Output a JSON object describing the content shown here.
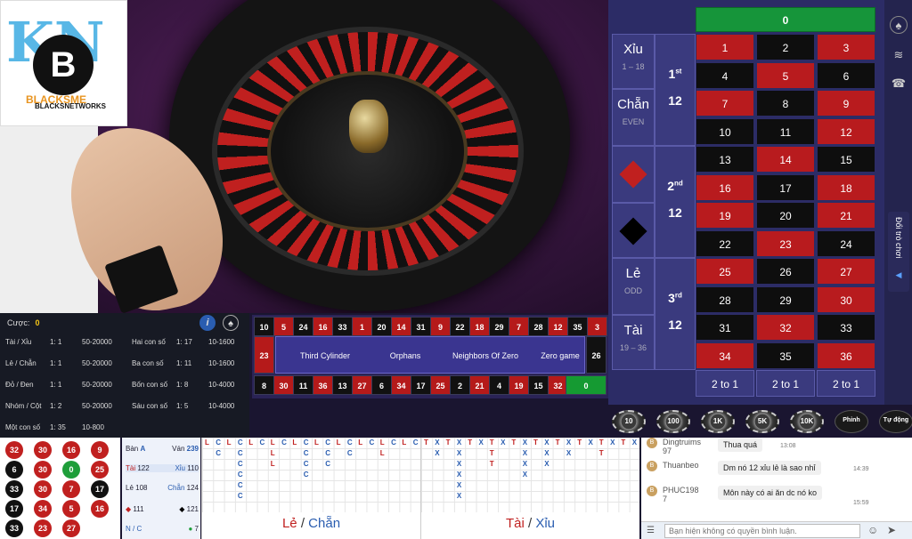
{
  "logo": {
    "letters": "KN",
    "circle_letter": "B",
    "tagline1": "BLACKS",
    "tagline2": "BLACKSNETWORKS",
    "domain_text": "ME"
  },
  "limits": {
    "bet_label": "Cược:",
    "bet_value": "0",
    "rows": [
      {
        "name": "Tài / Xỉu",
        "ratio": "1: 1",
        "range": "50-20000",
        "name2": "Hai con số",
        "ratio2": "1: 17",
        "range2": "10-1600"
      },
      {
        "name": "Lẻ / Chẵn",
        "ratio": "1: 1",
        "range": "50-20000",
        "name2": "Ba con số",
        "ratio2": "1: 11",
        "range2": "10-1600"
      },
      {
        "name": "Đỏ / Đen",
        "ratio": "1: 1",
        "range": "50-20000",
        "name2": "Bốn con số",
        "ratio2": "1: 8",
        "range2": "10-4000"
      },
      {
        "name": "Nhóm / Cột",
        "ratio": "1: 2",
        "range": "50-20000",
        "name2": "Sáu con số",
        "ratio2": "1: 5",
        "range2": "10-4000"
      },
      {
        "name": "Một con số",
        "ratio": "1: 35",
        "range": "10-800",
        "name2": "",
        "ratio2": "",
        "range2": ""
      }
    ]
  },
  "racetrack": {
    "top": [
      [
        "10",
        "blk"
      ],
      [
        "5",
        "red"
      ],
      [
        "24",
        "blk"
      ],
      [
        "16",
        "red"
      ],
      [
        "33",
        "blk"
      ],
      [
        "1",
        "red"
      ],
      [
        "20",
        "blk"
      ],
      [
        "14",
        "red"
      ],
      [
        "31",
        "blk"
      ],
      [
        "9",
        "red"
      ],
      [
        "22",
        "blk"
      ],
      [
        "18",
        "red"
      ],
      [
        "29",
        "blk"
      ],
      [
        "7",
        "red"
      ],
      [
        "28",
        "blk"
      ],
      [
        "12",
        "red"
      ],
      [
        "35",
        "blk"
      ],
      [
        "3",
        "red"
      ]
    ],
    "bottom": [
      [
        "8",
        "blk"
      ],
      [
        "30",
        "red"
      ],
      [
        "11",
        "blk"
      ],
      [
        "36",
        "red"
      ],
      [
        "13",
        "blk"
      ],
      [
        "27",
        "red"
      ],
      [
        "6",
        "blk"
      ],
      [
        "34",
        "red"
      ],
      [
        "17",
        "blk"
      ],
      [
        "25",
        "red"
      ],
      [
        "2",
        "blk"
      ],
      [
        "21",
        "red"
      ],
      [
        "4",
        "blk"
      ],
      [
        "19",
        "red"
      ],
      [
        "15",
        "blk"
      ],
      [
        "32",
        "red"
      ]
    ],
    "left": [
      "23",
      "red"
    ],
    "right": [
      "26",
      "blk"
    ],
    "zero": "0",
    "sections": [
      "Third Cylinder",
      "Orphans",
      "Neighbors Of Zero",
      "Zero game"
    ]
  },
  "chips": [
    "10",
    "100",
    "1K",
    "5K",
    "10K",
    "Phỉnh",
    "Tự động"
  ],
  "board": {
    "zero": "0",
    "grid": [
      [
        [
          "1",
          "red"
        ],
        [
          "2",
          "blk"
        ],
        [
          "3",
          "red"
        ]
      ],
      [
        [
          "4",
          "blk"
        ],
        [
          "5",
          "red"
        ],
        [
          "6",
          "blk"
        ]
      ],
      [
        [
          "7",
          "red"
        ],
        [
          "8",
          "blk"
        ],
        [
          "9",
          "red"
        ]
      ],
      [
        [
          "10",
          "blk"
        ],
        [
          "11",
          "blk"
        ],
        [
          "12",
          "red"
        ]
      ],
      [
        [
          "13",
          "blk"
        ],
        [
          "14",
          "red"
        ],
        [
          "15",
          "blk"
        ]
      ],
      [
        [
          "16",
          "red"
        ],
        [
          "17",
          "blk"
        ],
        [
          "18",
          "red"
        ]
      ],
      [
        [
          "19",
          "red"
        ],
        [
          "20",
          "blk"
        ],
        [
          "21",
          "red"
        ]
      ],
      [
        [
          "22",
          "blk"
        ],
        [
          "23",
          "red"
        ],
        [
          "24",
          "blk"
        ]
      ],
      [
        [
          "25",
          "red"
        ],
        [
          "26",
          "blk"
        ],
        [
          "27",
          "red"
        ]
      ],
      [
        [
          "28",
          "blk"
        ],
        [
          "29",
          "blk"
        ],
        [
          "30",
          "red"
        ]
      ],
      [
        [
          "31",
          "blk"
        ],
        [
          "32",
          "red"
        ],
        [
          "33",
          "blk"
        ]
      ],
      [
        [
          "34",
          "red"
        ],
        [
          "35",
          "blk"
        ],
        [
          "36",
          "red"
        ]
      ]
    ],
    "columns": [
      "2 to 1",
      "2 to 1",
      "2 to 1"
    ],
    "xiu": "Xỉu",
    "xiu_range": "1 – 18",
    "chan": "Chẵn",
    "chan_en": "EVEN",
    "le": "Lẻ",
    "le_en": "ODD",
    "tai": "Tài",
    "tai_range": "19 – 36",
    "dozen1": "1",
    "dozen1_sup": "st",
    "dozen2": "2",
    "dozen2_sup": "nd",
    "dozen3": "3",
    "dozen3_sup": "rd",
    "dozen_val": "12"
  },
  "side_tab": "Đổi trò chơi",
  "history": [
    [
      "32",
      "red"
    ],
    [
      "30",
      "red"
    ],
    [
      "16",
      "red"
    ],
    [
      "9",
      "red"
    ],
    [
      "6",
      "blk"
    ],
    [
      "30",
      "red"
    ],
    [
      "0",
      "grn"
    ],
    [
      "25",
      "red"
    ],
    [
      "33",
      "blk"
    ],
    [
      "30",
      "red"
    ],
    [
      "7",
      "red"
    ],
    [
      "17",
      "blk"
    ],
    [
      "17",
      "blk"
    ],
    [
      "34",
      "red"
    ],
    [
      "5",
      "red"
    ],
    [
      "16",
      "red"
    ],
    [
      "33",
      "blk"
    ],
    [
      "23",
      "red"
    ],
    [
      "27",
      "red"
    ]
  ],
  "stats": {
    "ban": "Bàn",
    "ban_val": "A",
    "van": "Ván",
    "van_val": "239",
    "tai": "Tài",
    "tai_val": "122",
    "xiu": "Xỉu",
    "xiu_val": "110",
    "le": "Lẻ",
    "le_val": "108",
    "chan": "Chẵn",
    "chan_val": "124",
    "red_val": "111",
    "blk_val": "121",
    "nc": "N / C",
    "green_val": "7"
  },
  "road1": {
    "title_a": "Lẻ",
    "sep": " / ",
    "title_b": "Chẵn"
  },
  "road2": {
    "title_a": "Tài",
    "sep": " / ",
    "title_b": "Xỉu"
  },
  "chat": {
    "messages": [
      {
        "name": "Dingtruims 97",
        "text": "Thua quá",
        "time": "13:08"
      },
      {
        "name": "Thuanbeo",
        "text": "Dm nó 12 xỉu lẻ là sao nhỉ",
        "time": "14:39"
      },
      {
        "name": "PHUC198 7",
        "text": "Môn này có ai ăn dc nó ko",
        "time": "15:59"
      }
    ],
    "placeholder": "Bạn hiện không có quyền bình luận."
  }
}
